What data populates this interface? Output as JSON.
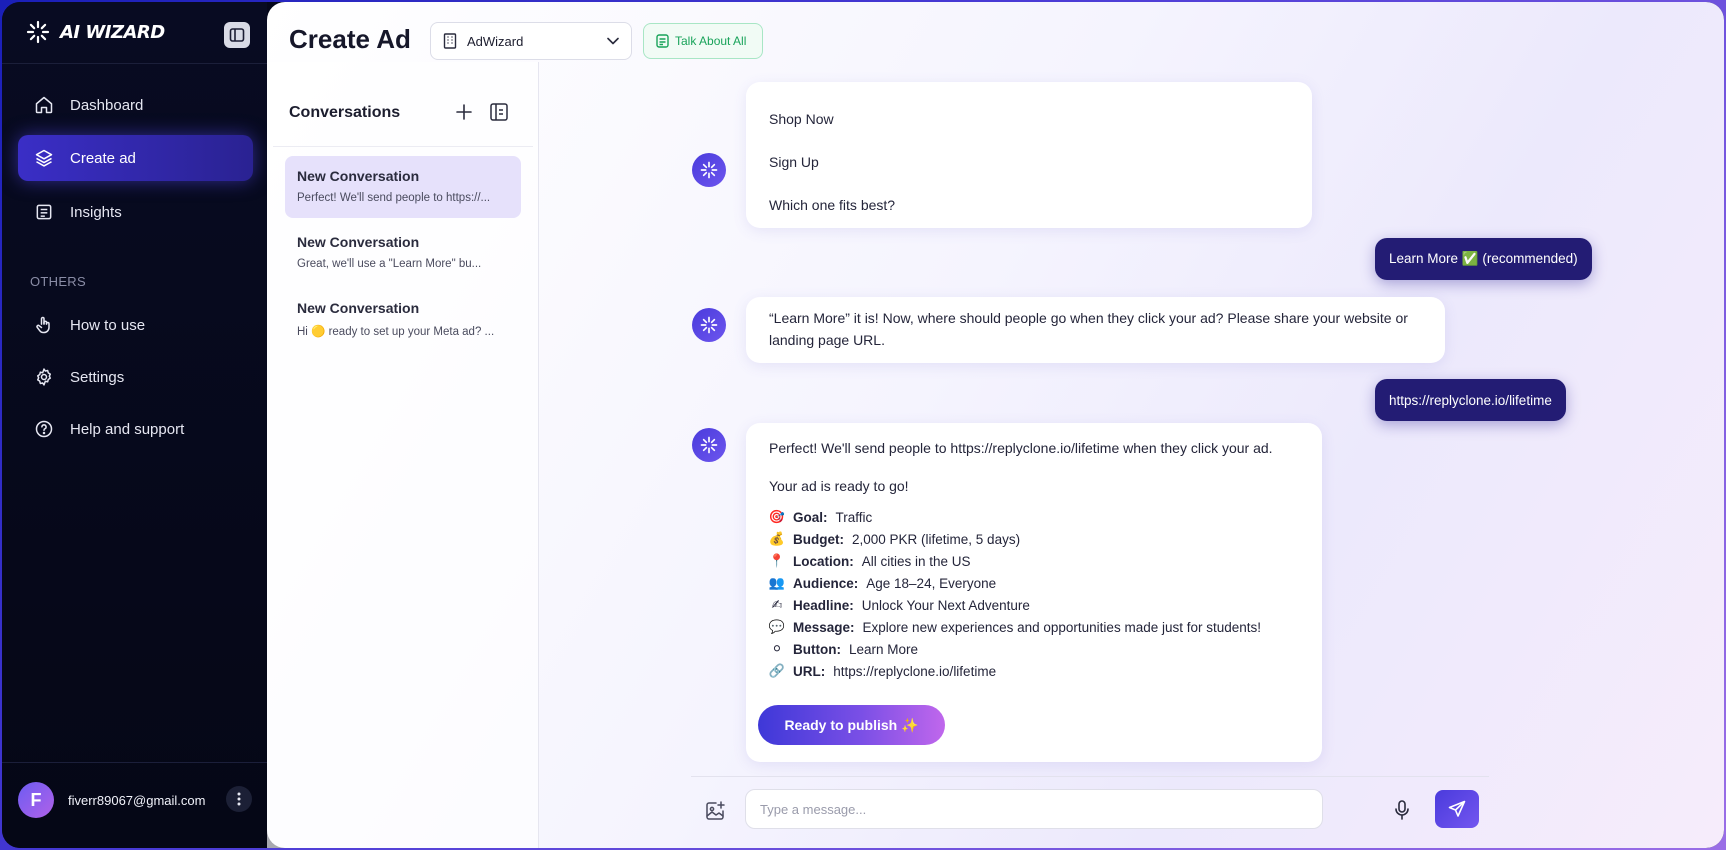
{
  "app": {
    "brand": "AI WIZARD"
  },
  "sidebar": {
    "items": [
      {
        "label": "Dashboard",
        "icon": "home-icon"
      },
      {
        "label": "Create ad",
        "icon": "layers-icon",
        "active": true
      },
      {
        "label": "Insights",
        "icon": "document-icon"
      }
    ],
    "others_label": "OTHERS",
    "others": [
      {
        "label": "How to use",
        "icon": "hand-pointer-icon"
      },
      {
        "label": "Settings",
        "icon": "gear-icon"
      },
      {
        "label": "Help and support",
        "icon": "help-circle-icon"
      }
    ],
    "user": {
      "initial": "F",
      "email": "fiverr89067@gmail.com"
    }
  },
  "header": {
    "title": "Create Ad",
    "workspace": "AdWizard",
    "talk_button": "Talk About All"
  },
  "conversations": {
    "title": "Conversations",
    "items": [
      {
        "title": "New Conversation",
        "preview": "Perfect! We'll send people to https://...",
        "active": true
      },
      {
        "title": "New Conversation",
        "preview": "Great, we'll use a \"Learn More\" bu..."
      },
      {
        "title": "New Conversation",
        "preview": "Hi 🟡 ready to set up your Meta ad? ..."
      }
    ]
  },
  "chat": {
    "msg1": {
      "options": [
        "Shop Now",
        "Sign Up"
      ],
      "question": "Which one fits best?"
    },
    "reply1": "Learn More ✅ (recommended)",
    "msg2": "“Learn More” it is! Now, where should people go when they click your ad? Please share your website or landing page URL.",
    "reply2": "https://replyclone.io/lifetime",
    "msg3": {
      "intro": "Perfect! We'll send people to https://replyclone.io/lifetime when they click your ad.",
      "ready": "Your ad is ready to go!",
      "summary": [
        {
          "emoji": "🎯",
          "label": "Goal:",
          "value": "Traffic"
        },
        {
          "emoji": "💰",
          "label": "Budget:",
          "value": "2,000 PKR (lifetime, 5 days)"
        },
        {
          "emoji": "📍",
          "label": "Location:",
          "value": "All cities in the US"
        },
        {
          "emoji": "👥",
          "label": "Audience:",
          "value": "Age 18–24, Everyone"
        },
        {
          "emoji": "✍",
          "label": "Headline:",
          "value": "Unlock Your Next Adventure"
        },
        {
          "emoji": "💬",
          "label": "Message:",
          "value": "Explore new experiences and opportunities made just for students!"
        },
        {
          "emoji": "⚪",
          "label": "Button:",
          "value": "Learn More"
        },
        {
          "emoji": "🔗",
          "label": "URL:",
          "value": "https://replyclone.io/lifetime"
        }
      ],
      "publish_button": "Ready to publish ✨"
    }
  },
  "composer": {
    "placeholder": "Type a message..."
  },
  "colors": {
    "accent": "#3a2ec6",
    "user_bubble": "#231c74",
    "talk_green": "#19a35a"
  }
}
